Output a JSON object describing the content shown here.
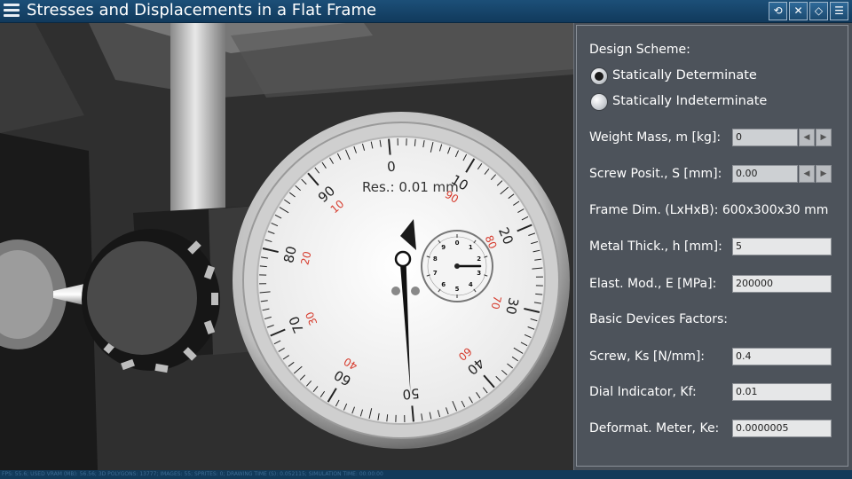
{
  "app": {
    "title": "Stresses and Displacements in a Flat Frame"
  },
  "toolbar": {
    "buttons": [
      {
        "icon": "reset-view-icon",
        "glyph": "⟲"
      },
      {
        "icon": "sound-mute-icon",
        "glyph": "✕"
      },
      {
        "icon": "erase-icon",
        "glyph": "◇"
      },
      {
        "icon": "list-settings-icon",
        "glyph": "☰"
      }
    ]
  },
  "dial": {
    "resolution_label": "Res.: 0.01 mm",
    "outer_labels": [
      "0",
      "10",
      "20",
      "30",
      "40",
      "50",
      "60",
      "70",
      "80",
      "90"
    ],
    "inner_red_labels": [
      "10",
      "20",
      "30",
      "40",
      "60",
      "70",
      "80",
      "90"
    ],
    "small_dial_labels": [
      "0",
      "1",
      "2",
      "3",
      "4",
      "5",
      "6",
      "7",
      "8",
      "9"
    ],
    "main_needle_reading": 50.5,
    "small_needle_reading": 2.5
  },
  "panel": {
    "design_scheme_label": "Design Scheme:",
    "radio_options": [
      {
        "label": "Statically Determinate",
        "selected": true
      },
      {
        "label": "Statically Indeterminate",
        "selected": false
      }
    ],
    "weight_mass": {
      "label": "Weight Mass, m [kg]:",
      "value": "0"
    },
    "screw_position": {
      "label": "Screw Posit., S [mm]:",
      "value": "0.00"
    },
    "frame_dim": {
      "label": "Frame Dim. (LxHxB): 600x300x30 mm"
    },
    "metal_thickness": {
      "label": "Metal Thick., h [mm]:",
      "value": "5"
    },
    "elastic_modulus": {
      "label": "Elast. Mod., E [MPa]:",
      "value": "200000"
    },
    "basic_factors_label": "Basic Devices Factors:",
    "screw_factor": {
      "label": "Screw, Ks [N/mm]:",
      "value": "0.4"
    },
    "dial_factor": {
      "label": "Dial Indicator, Kf:",
      "value": "0.01"
    },
    "deformat_factor": {
      "label": "Deformat. Meter, Ke:",
      "value": "0.0000005"
    }
  },
  "status": {
    "text": "FPS: 55.6; USED VRAM (MB): 56.56; 3D POLYGONS: 13777; IMAGES: 55; SPRITES: 0; DRAWING TIME (S): 0.052115; SIMULATION TIME: 00:00:00"
  }
}
